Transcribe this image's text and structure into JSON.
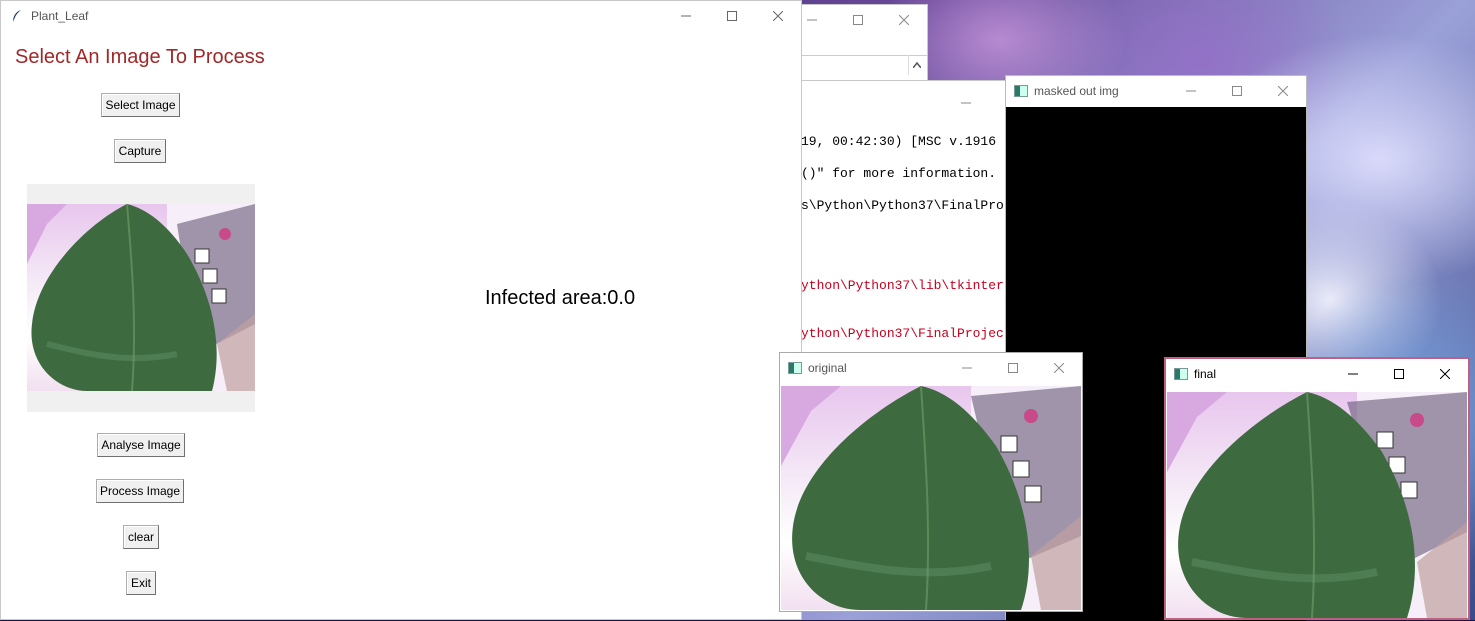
{
  "main_window": {
    "title": "Plant_Leaf",
    "heading": "Select An Image To Process",
    "buttons": {
      "select_image": "Select Image",
      "capture": "Capture",
      "analyse_image": "Analyse Image",
      "process_image": "Process Image",
      "clear": "clear",
      "exit": "Exit"
    },
    "infected_area": "Infected area:0.0"
  },
  "console": {
    "lines": [
      {
        "text": "19, 00:42:30) [MSC v.1916",
        "type": "normal"
      },
      {
        "text": "()\" for more information.",
        "type": "normal"
      },
      {
        "text": "s\\Python\\Python37\\FinalPro",
        "type": "normal"
      },
      {
        "text": "ython\\Python37\\lib\\tkinter",
        "type": "error"
      },
      {
        "text": "ython\\Python37\\FinalProjec",
        "type": "error"
      }
    ]
  },
  "cv_windows": {
    "masked": {
      "title": "masked out img"
    },
    "original": {
      "title": "original"
    },
    "final": {
      "title": "final"
    }
  },
  "colors": {
    "heading": "#a02828",
    "error_text": "#c8001e",
    "leaf": "#3e6a40"
  },
  "icons": {
    "window_minimize": "minimize-icon",
    "window_maximize": "maximize-icon",
    "window_close": "close-icon",
    "tk_feather": "feather-icon",
    "cv_window": "image-window-icon"
  }
}
